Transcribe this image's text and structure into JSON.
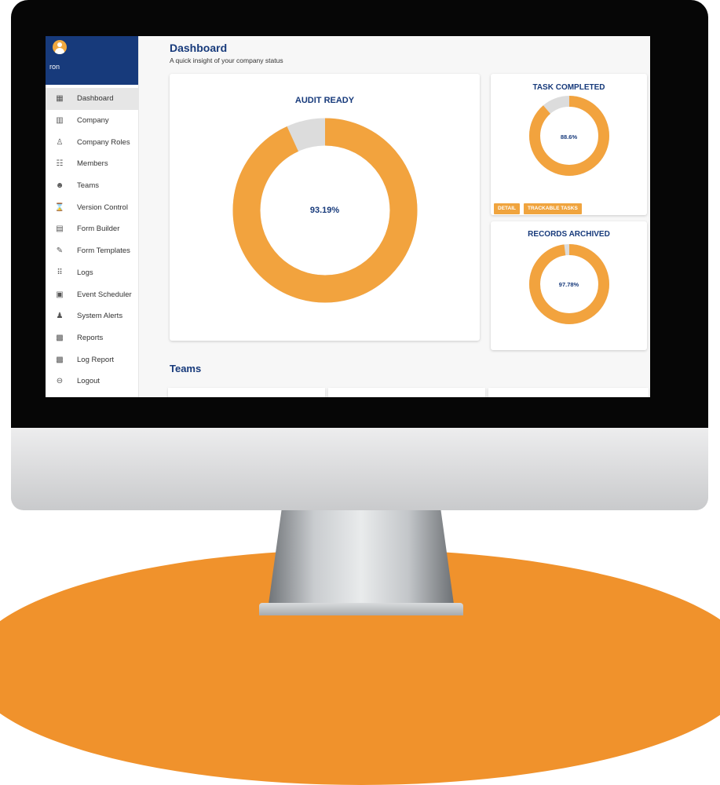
{
  "user": {
    "name": "ron"
  },
  "sidebar": {
    "items": [
      {
        "label": "Dashboard",
        "icon": "dashboard-icon",
        "glyph": "▦",
        "active": true
      },
      {
        "label": "Company",
        "icon": "building-icon",
        "glyph": "▥"
      },
      {
        "label": "Company Roles",
        "icon": "person-icon",
        "glyph": "♙"
      },
      {
        "label": "Members",
        "icon": "people-icon",
        "glyph": "☷"
      },
      {
        "label": "Teams",
        "icon": "team-icon",
        "glyph": "☻"
      },
      {
        "label": "Version Control",
        "icon": "hourglass-icon",
        "glyph": "⌛"
      },
      {
        "label": "Form Builder",
        "icon": "form-icon",
        "glyph": "▤"
      },
      {
        "label": "Form Templates",
        "icon": "brush-icon",
        "glyph": "✎"
      },
      {
        "label": "Logs",
        "icon": "grid-icon",
        "glyph": "⠿"
      },
      {
        "label": "Event Scheduler",
        "icon": "calendar-icon",
        "glyph": "▣"
      },
      {
        "label": "System Alerts",
        "icon": "bell-icon",
        "glyph": "♟"
      },
      {
        "label": "Reports",
        "icon": "clipboard-icon",
        "glyph": "▩"
      },
      {
        "label": "Log Report",
        "icon": "clipboard-icon",
        "glyph": "▩"
      },
      {
        "label": "Logout",
        "icon": "logout-icon",
        "glyph": "⊖"
      }
    ]
  },
  "header": {
    "title": "Dashboard",
    "subtitle": "A quick insight of your company status"
  },
  "cards": {
    "audit": {
      "title": "AUDIT READY",
      "value": 93.19,
      "label": "93.19%"
    },
    "task": {
      "title": "TASK COMPLETED",
      "value": 88.6,
      "label": "88.6%"
    },
    "records": {
      "title": "RECORDS ARCHIVED",
      "value": 97.78,
      "label": "97.78%"
    }
  },
  "buttons": {
    "detail": "DETAIL",
    "trackable": "TRACKABLE TASKS"
  },
  "teams": {
    "title": "Teams"
  },
  "colors": {
    "accent": "#f2a33e",
    "track": "#dcdcdc",
    "brand": "#173a7b"
  }
}
